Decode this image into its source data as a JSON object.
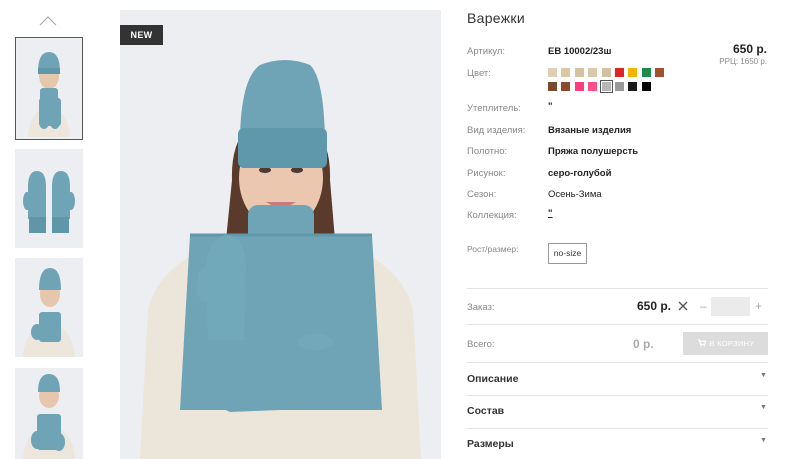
{
  "product": {
    "title": "Варежки",
    "badge": "NEW",
    "price": "650 р.",
    "rrc": "РРЦ: 1650 р."
  },
  "attributes": {
    "article_label": "Артикул:",
    "article_value": "ЕВ 10002/23ш",
    "color_label": "Цвет:",
    "insulation_label": "Утеплитель:",
    "insulation_value": "\"",
    "type_label": "Вид изделия:",
    "type_value": "Вязаные изделия",
    "fabric_label": "Полотно:",
    "fabric_value": "Пряжа полушерсть",
    "pattern_label": "Рисунок:",
    "pattern_value": "серо-голубой",
    "season_label": "Сезон:",
    "season_value": "Осень-Зима",
    "collection_label": "Коллекция:",
    "collection_value": "\"",
    "size_label": "Рост/размер:",
    "size_value": "no-size"
  },
  "swatches": [
    {
      "color": "#dccfb4"
    },
    {
      "color": "#d9c7a6"
    },
    {
      "color": "#d4c3a3"
    },
    {
      "color": "#d9c9ab"
    },
    {
      "color": "#d2c0a2"
    },
    {
      "color": "#e02424"
    },
    {
      "color": "#f4b400"
    },
    {
      "color": "#1e8a4c"
    },
    {
      "color": "#a0522d"
    },
    {
      "color": "#7a4a2c"
    },
    {
      "color": "#8b4a2b"
    },
    {
      "color": "#ff3c7d"
    },
    {
      "color": "#ff4f8b"
    },
    {
      "color": "#b7b7b7",
      "selected": true
    },
    {
      "color": "#999999"
    },
    {
      "color": "#1a1a1a"
    },
    {
      "color": "#000000"
    }
  ],
  "order": {
    "order_label": "Заказ:",
    "order_price": "650 р.",
    "minus": "–",
    "plus": "+",
    "total_label": "Всего:",
    "total_value": "0 р.",
    "cart_button": "В КОРЗИНУ"
  },
  "accordion": [
    {
      "title": "Описание"
    },
    {
      "title": "Состав"
    },
    {
      "title": "Размеры"
    }
  ]
}
